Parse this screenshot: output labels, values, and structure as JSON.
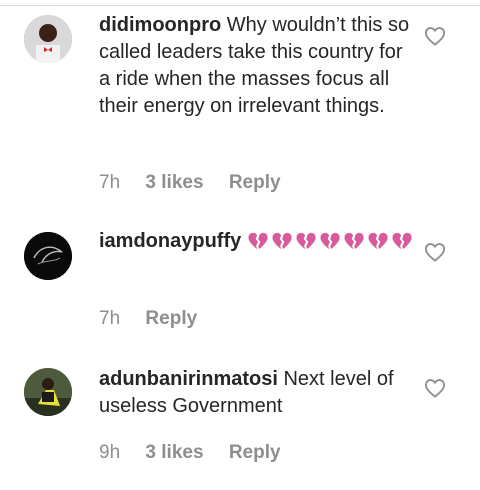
{
  "comments": [
    {
      "username": "didimoonpro",
      "text": "Why wouldn’t this so called leaders take this country for a ride when the masses focus all their energy on irrelevant things.",
      "time": "7h",
      "likes": "3 likes",
      "reply": "Reply",
      "avatar_icon": "user-avatar",
      "like_icon": "heart-outline-icon"
    },
    {
      "username": "iamdonaypuffy",
      "emoji": "broken-heart",
      "emoji_count": 7,
      "emoji_color": "#d85a9b",
      "time": "7h",
      "reply": "Reply",
      "avatar_icon": "user-avatar",
      "like_icon": "heart-outline-icon"
    },
    {
      "username": "adunbanirinmatosi",
      "text": "Next level of useless Government",
      "time": "9h",
      "likes": "3 likes",
      "reply": "Reply",
      "avatar_icon": "user-avatar",
      "like_icon": "heart-outline-icon"
    }
  ]
}
